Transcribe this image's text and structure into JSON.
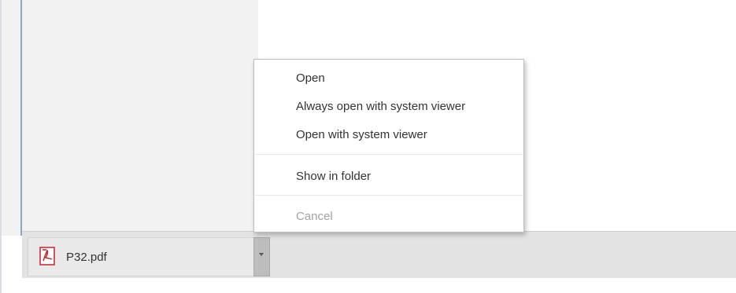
{
  "downloads": {
    "item": {
      "file_name": "P32.pdf",
      "icon": "pdf-icon"
    },
    "menu_icon": "chevron-down-icon"
  },
  "context_menu": {
    "items": [
      {
        "label": "Open",
        "enabled": true
      },
      {
        "label": "Always open with system viewer",
        "enabled": true
      },
      {
        "label": "Open with system viewer",
        "enabled": true
      },
      {
        "label": "Show in folder",
        "enabled": true
      },
      {
        "label": "Cancel",
        "enabled": false
      }
    ]
  },
  "colors": {
    "pdf_red": "#c8202b",
    "menu_text": "#333333",
    "disabled_text": "#a3a3a3"
  }
}
